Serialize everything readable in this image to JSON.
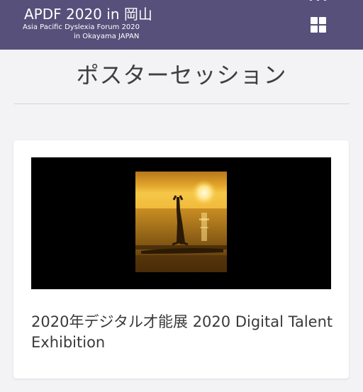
{
  "header": {
    "logo_title": "APDF 2020 in 岡山",
    "logo_subtitle_line1": "Asia Pacific Dyslexia Forum 2020",
    "logo_subtitle_line2": "in Okayama JAPAN",
    "menu_icon": "grid-icon",
    "colors": {
      "background": "#56507a",
      "text": "#ffffff"
    }
  },
  "page": {
    "title": "ポスターセッション"
  },
  "cards": [
    {
      "title": "2020年デジタル才能展 2020 Digital Talent Exhibition",
      "image": "sunset-headstand-photo"
    }
  ]
}
